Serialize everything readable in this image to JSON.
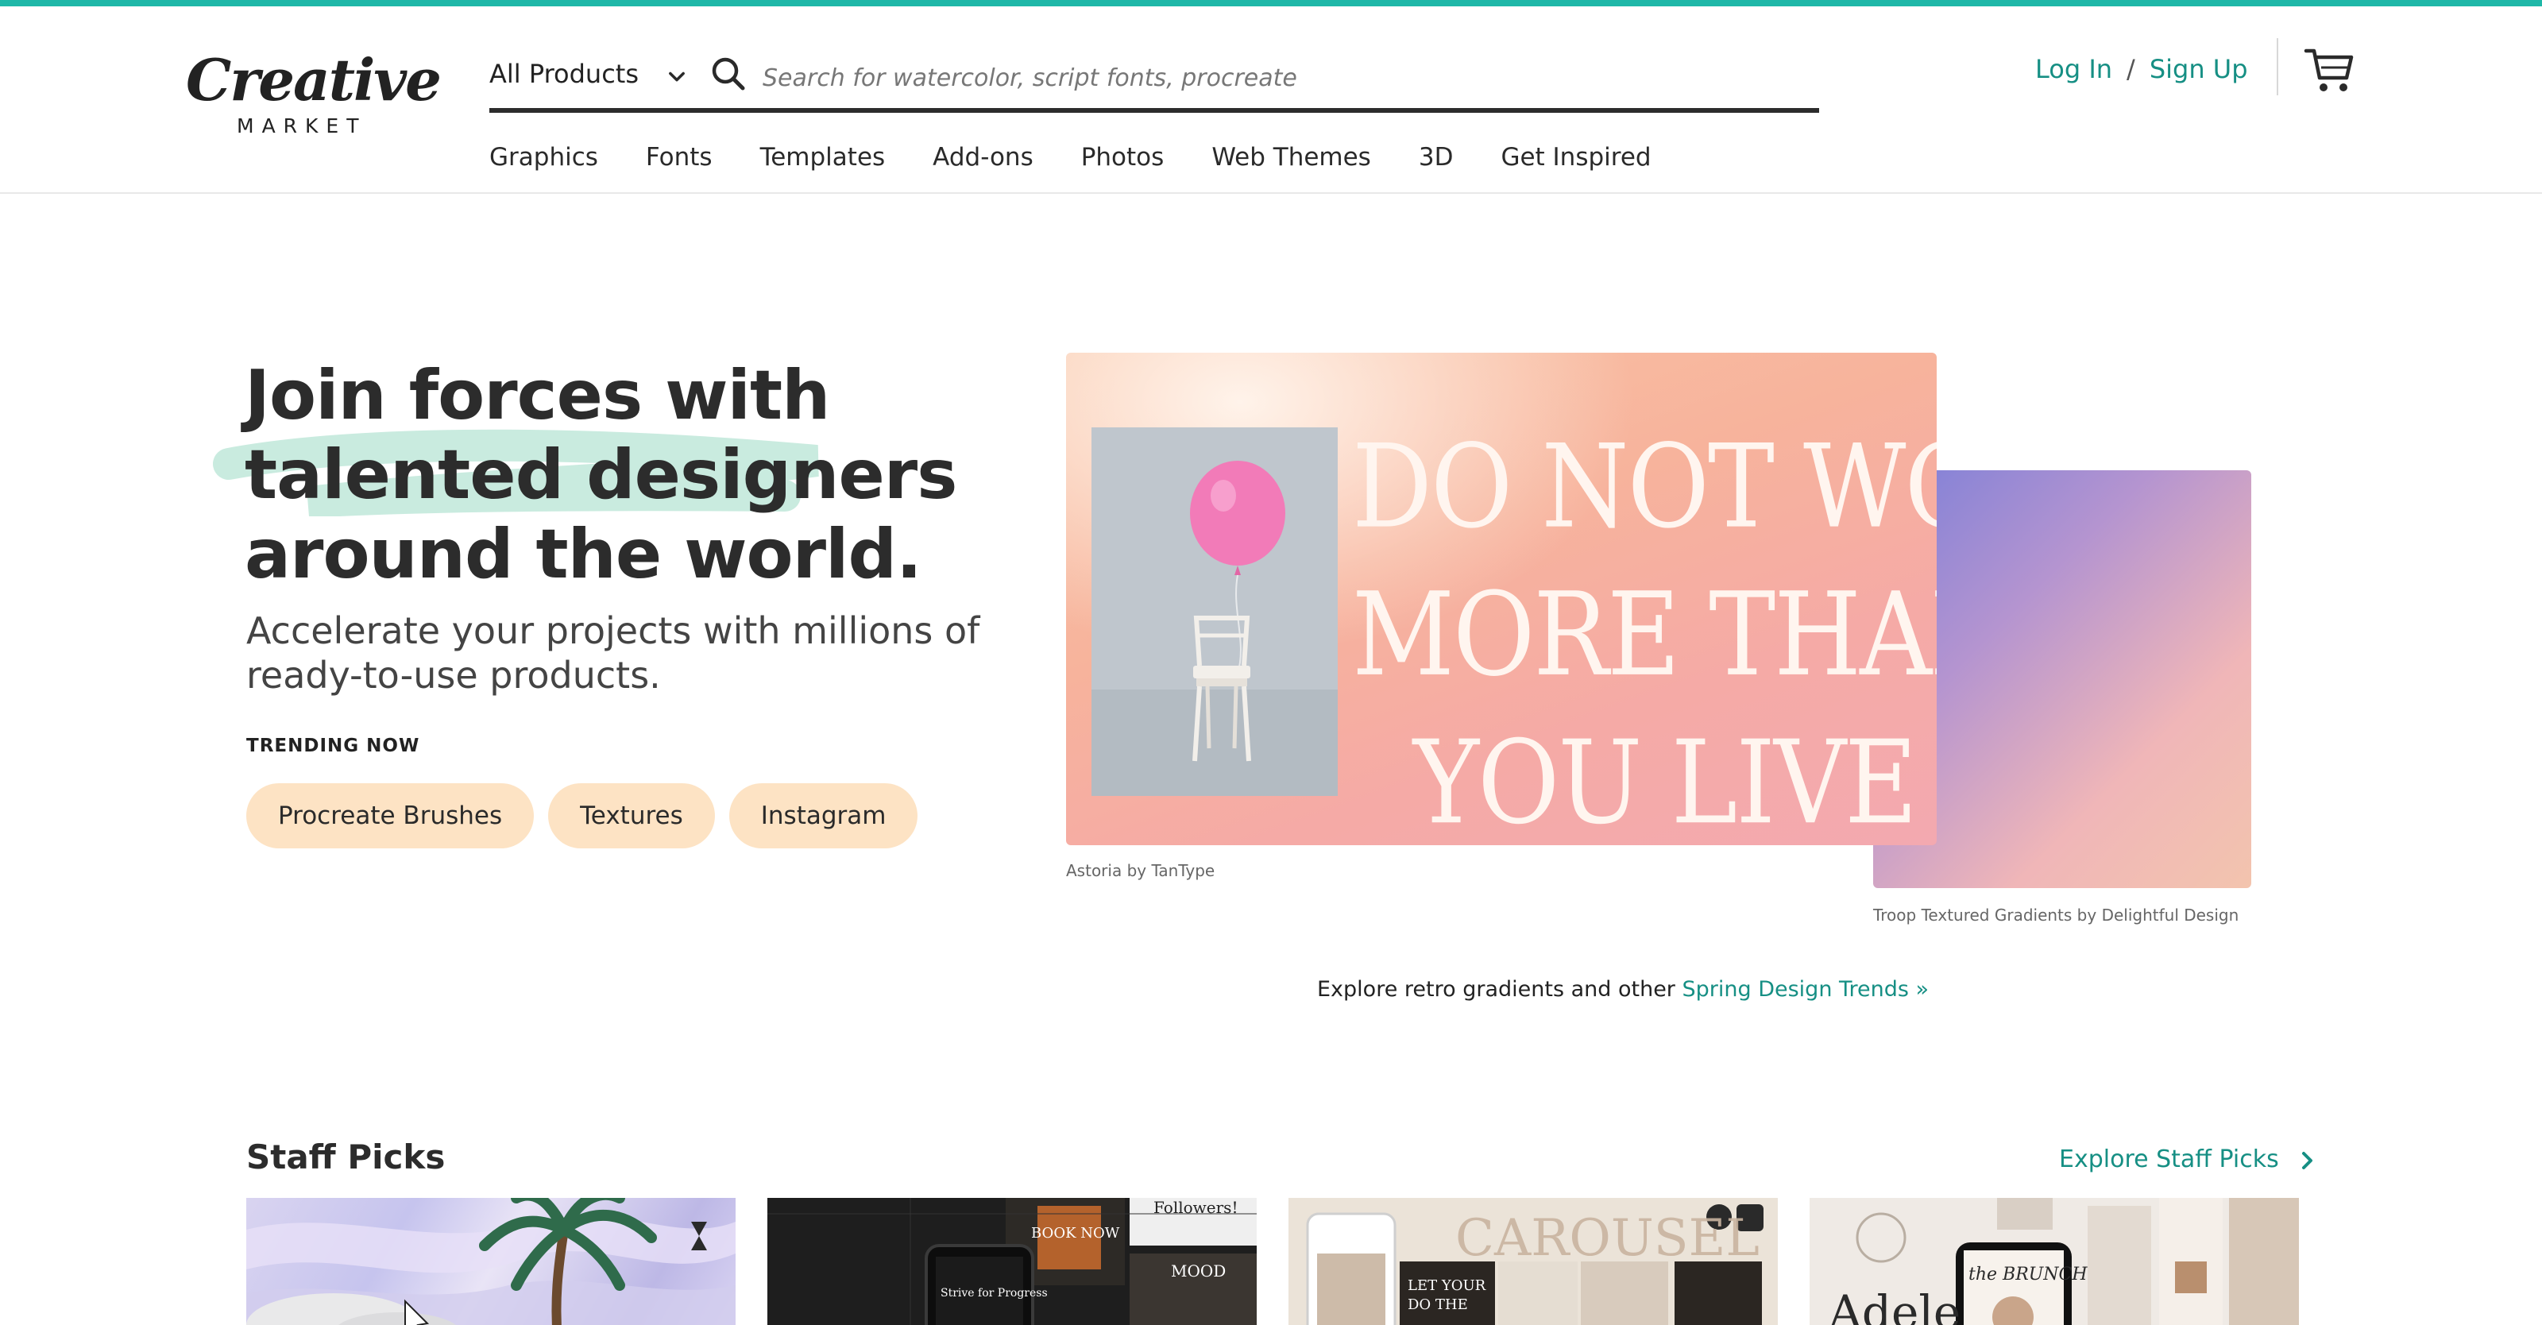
{
  "brand": {
    "logo_word": "Creative",
    "logo_sub": "MARKET",
    "accent": "#168f84",
    "topbar_color": "#1fb8a8"
  },
  "search": {
    "category": "All Products",
    "placeholder": "Search for watercolor, script fonts, procreate",
    "value": ""
  },
  "auth": {
    "login": "Log In",
    "separator": "/",
    "signup": "Sign Up"
  },
  "icons": {
    "cart": "cart-icon",
    "search": "search-icon",
    "dropdown": "chevron-down-icon"
  },
  "nav": [
    "Graphics",
    "Fonts",
    "Templates",
    "Add-ons",
    "Photos",
    "Web Themes",
    "3D",
    "Get Inspired"
  ],
  "hero": {
    "title_lines": [
      "Join forces with",
      "talented designers",
      "around the world."
    ],
    "subtitle": "Accelerate your projects with millions of ready-to-use products.",
    "trending_label": "TRENDING NOW",
    "pills": [
      "Procreate Brushes",
      "Textures",
      "Instagram"
    ],
    "pill_color": "#fde3c4"
  },
  "feature": {
    "front_text_lines": [
      "DO NOT WORK",
      "MORE THAN",
      "YOU LIVE"
    ],
    "caption_front": "Astoria by TanType",
    "caption_back": "Troop Textured Gradients by Delightful Design",
    "explore_prefix": "Explore retro gradients and other",
    "explore_link": "Spring Design Trends »"
  },
  "staff": {
    "title": "Staff Picks",
    "link": "Explore Staff Picks",
    "tiles": [
      {
        "text": ""
      },
      {
        "text": "BOOK NOW",
        "text2": "Followers!",
        "text3": "MOOD",
        "text4": "Strive for Progress"
      },
      {
        "text": "CAROUSEL",
        "text2": "LET YOUR",
        "text3": "DO THE"
      },
      {
        "text": "Adele",
        "text2": "the BRUNCH"
      }
    ]
  }
}
